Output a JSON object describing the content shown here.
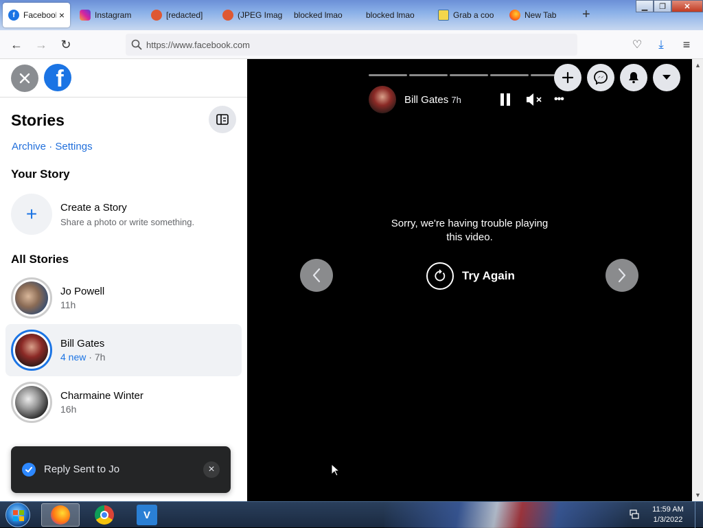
{
  "browser": {
    "tabs": [
      {
        "title": "Facebook",
        "close": "×",
        "icon": "facebook-icon",
        "active": true
      },
      {
        "title": "Instagram",
        "icon": "instagram-icon"
      },
      {
        "title": "[redacted]",
        "icon": "duckduckgo-icon"
      },
      {
        "title": "(JPEG Imag",
        "icon": "duckduckgo-icon"
      },
      {
        "title": "blocked lmao",
        "icon": ""
      },
      {
        "title": "blocked lmao",
        "icon": ""
      },
      {
        "title": "Grab a coo",
        "icon": "page-icon"
      },
      {
        "title": "New Tab",
        "icon": "firefox-icon"
      }
    ],
    "new_tab": "+",
    "url": "https://www.facebook.com"
  },
  "sidebar": {
    "title": "Stories",
    "links": {
      "archive": "Archive",
      "sep": "·",
      "settings": "Settings"
    },
    "your_story": "Your Story",
    "create": {
      "plus": "+",
      "title": "Create a Story",
      "subtitle": "Share a photo or write something."
    },
    "all_stories": "All Stories",
    "stories": [
      {
        "name": "Jo Powell",
        "time": "11h"
      },
      {
        "name": "Bill Gates",
        "new_label": "4 new",
        "sep": " · ",
        "time": "7h",
        "selected": true
      },
      {
        "name": "Charmaine Winter",
        "time": "16h"
      }
    ]
  },
  "toast": {
    "text": "Reply Sent to Jo",
    "close": "×"
  },
  "viewer": {
    "author": "Bill Gates",
    "time": "7h",
    "more": "•••",
    "error_line1": "Sorry, we're having trouble playing",
    "error_line2": "this video.",
    "retry": "Try Again",
    "segments": 5
  },
  "taskbar": {
    "time": "11:59 AM",
    "date": "1/3/2022"
  },
  "colors": {
    "facebook_blue": "#1b74e4",
    "link_blue": "#216fdb"
  }
}
